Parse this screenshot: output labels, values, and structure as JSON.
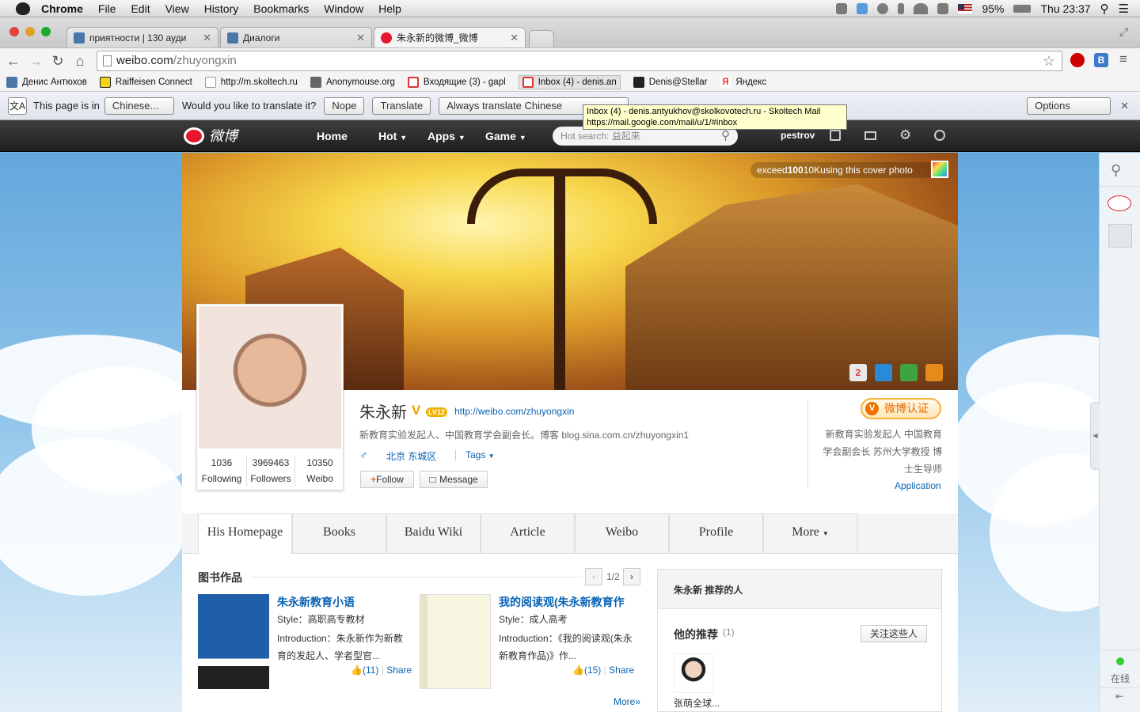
{
  "menubar": {
    "app": "Chrome",
    "items": [
      "File",
      "Edit",
      "View",
      "History",
      "Bookmarks",
      "Window",
      "Help"
    ],
    "battery": "95%",
    "clock": "Thu 23:37"
  },
  "tabs": [
    {
      "title": "приятности | 130 ауди",
      "color": "#4a76a8"
    },
    {
      "title": "Диалоги",
      "color": "#4a76a8"
    },
    {
      "title": "朱永新的微博_微博",
      "color": "#e6162d"
    }
  ],
  "address": {
    "host": "weibo.com",
    "path": "/zhuyongxin"
  },
  "bookmarks": [
    {
      "label": "Денис Антюхов",
      "color": "#4a76a8"
    },
    {
      "label": "Raiffeisen Connect",
      "color": "#f2d21b"
    },
    {
      "label": "http://m.skoltech.ru",
      "color": "#ddd"
    },
    {
      "label": "Anonymouse.org",
      "color": "#666"
    },
    {
      "label": "Входящие (3) - gapl",
      "color": "#d33"
    },
    {
      "label": "Inbox (4) - denis.an",
      "color": "#d33"
    },
    {
      "label": "Denis@Stellar",
      "color": "#222"
    },
    {
      "label": "Яндекс",
      "color": "#e33"
    }
  ],
  "translate": {
    "prefix": "This page is in",
    "language": "Chinese...",
    "question": "Would you like to translate it?",
    "nope": "Nope",
    "translate": "Translate",
    "always": "Always translate Chinese",
    "options": "Options"
  },
  "tooltip": {
    "line1": "Inbox (4) - denis.antyukhov@skolkovotech.ru - Skoltech Mail",
    "line2": "https://mail.google.com/mail/u/1/#inbox"
  },
  "weibo_nav": {
    "logo": "微博",
    "home": "Home",
    "hot": "Hot",
    "apps": "Apps",
    "game": "Game",
    "search_placeholder": "Hot search: 益起来",
    "user": "pestrov"
  },
  "cover": {
    "note_pre": "exceed",
    "note_bold": "100",
    "note_post": "10Kusing this cover photo"
  },
  "profile": {
    "name": "朱永新",
    "level": "LV12",
    "url": "http://weibo.com/zhuyongxin",
    "bio": "新教育实验发起人、中国教育学会副会长。博客 blog.sina.com.cn/zhuyongxin1",
    "location": "北京 东城区",
    "tags": "Tags",
    "follow": "Follow",
    "message": "Message",
    "stats": [
      {
        "value": "1036",
        "label": "Following"
      },
      {
        "value": "3969463",
        "label": "Followers"
      },
      {
        "value": "10350",
        "label": "Weibo"
      }
    ],
    "verified_badge": "微博认证",
    "verified_desc": "新教育实验发起人 中国教育学会副会长 苏州大学教授 博士生导师",
    "application": "Application"
  },
  "profile_tabs": [
    "His Homepage",
    "Books",
    "Baidu Wiki",
    "Article",
    "Weibo",
    "Profile",
    "More"
  ],
  "books": {
    "section_title": "图书作品",
    "pager": "1/2",
    "more": "More»",
    "items": [
      {
        "title": "朱永新教育小语",
        "style": "Style：高职高专教材",
        "intro": "Introduction：朱永新作为新教育的发起人、学者型官...",
        "likes": "(11)",
        "share": "Share"
      },
      {
        "title": "我的阅读观(朱永新教育作",
        "style": "Style：成人高考",
        "intro": "Introduction：《我的阅读观(朱永新教育作品)》作...",
        "likes": "(15)",
        "share": "Share"
      }
    ]
  },
  "recommend": {
    "header": "朱永新 推荐的人",
    "title": "他的推荐",
    "count": "(1)",
    "follow_all": "关注这些人",
    "person": "张萌全球..."
  },
  "sidebar": {
    "online": "在线"
  }
}
